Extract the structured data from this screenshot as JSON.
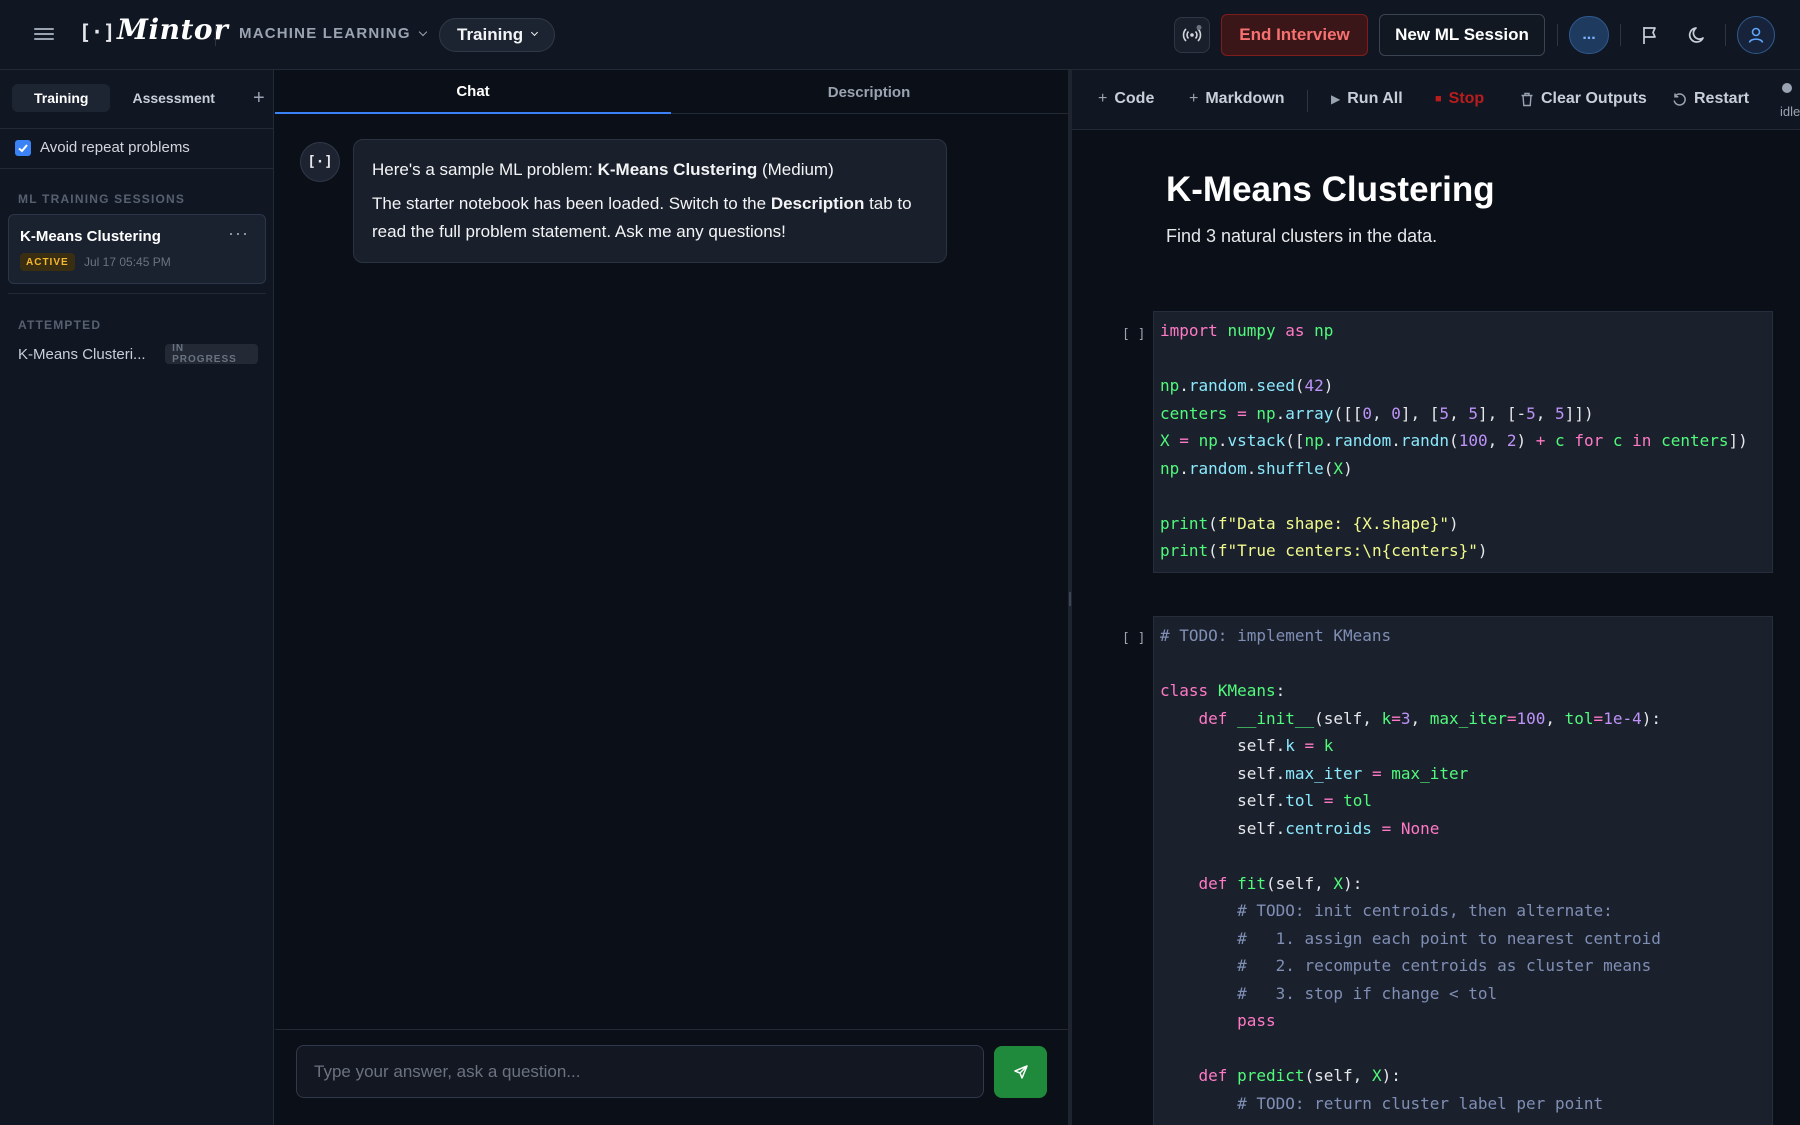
{
  "header": {
    "logo_mark": "[·]",
    "logo_text": "Mintor",
    "domain": "MACHINE LEARNING",
    "mode": "Training",
    "end_interview": "End Interview",
    "new_session": "New ML Session",
    "more": "...",
    "icons": [
      "menu-icon",
      "broadcast-icon",
      "flag-icon",
      "moon-icon",
      "user-icon"
    ]
  },
  "sidebar": {
    "tabs": [
      "Training",
      "Assessment"
    ],
    "add": "+",
    "avoid_repeat": "Avoid repeat problems",
    "avoid_repeat_checked": true,
    "sessions_label": "ML TRAINING SESSIONS",
    "session": {
      "title": "K-Means Clustering",
      "status": "ACTIVE",
      "time": "Jul 17 05:45 PM",
      "more": "···"
    },
    "attempted_label": "ATTEMPTED",
    "attempted": {
      "name": "K-Means Clusteri...",
      "status": "IN PROGRESS"
    }
  },
  "chat": {
    "tabs": [
      "Chat",
      "Description"
    ],
    "active_tab": "Chat",
    "bot_avatar": "[·]",
    "message": {
      "p1_prefix": "Here's a sample ML problem: ",
      "p1_bold": "K-Means Clustering",
      "p1_suffix": " (Medium)",
      "p2_prefix": "The starter notebook has been loaded. Switch to the ",
      "p2_bold": "Description",
      "p2_suffix": " tab to read the full problem statement. Ask me any questions!"
    },
    "input_placeholder": "Type your answer, ask a question..."
  },
  "notebook": {
    "toolbar": {
      "code": "Code",
      "markdown": "Markdown",
      "run_all": "Run All",
      "stop": "Stop",
      "clear_outputs": "Clear Outputs",
      "restart": "Restart",
      "kernel_status": "idle"
    },
    "markdown_title": "K-Means Clustering",
    "markdown_text": "Find 3 natural clusters in the data.",
    "exec_count": "[ ]",
    "cell1_source": "import numpy as np\n\nnp.random.seed(42)\ncenters = np.array([[0, 0], [5, 5], [-5, 5]])\nX = np.vstack([np.random.randn(100, 2) + c for c in centers])\nnp.random.shuffle(X)\n\nprint(f\"Data shape: {X.shape}\")\nprint(f\"True centers:\\n{centers}\")",
    "cell2_source": "# TODO: implement KMeans\n\nclass KMeans:\n    def __init__(self, k=3, max_iter=100, tol=1e-4):\n        self.k = k\n        self.max_iter = max_iter\n        self.tol = tol\n        self.centroids = None\n\n    def fit(self, X):\n        # TODO: init centroids, then alternate:\n        #   1. assign each point to nearest centroid\n        #   2. recompute centroids as cluster means\n        #   3. stop if change < tol\n        pass\n\n    def predict(self, X):\n        # TODO: return cluster label per point"
  }
}
